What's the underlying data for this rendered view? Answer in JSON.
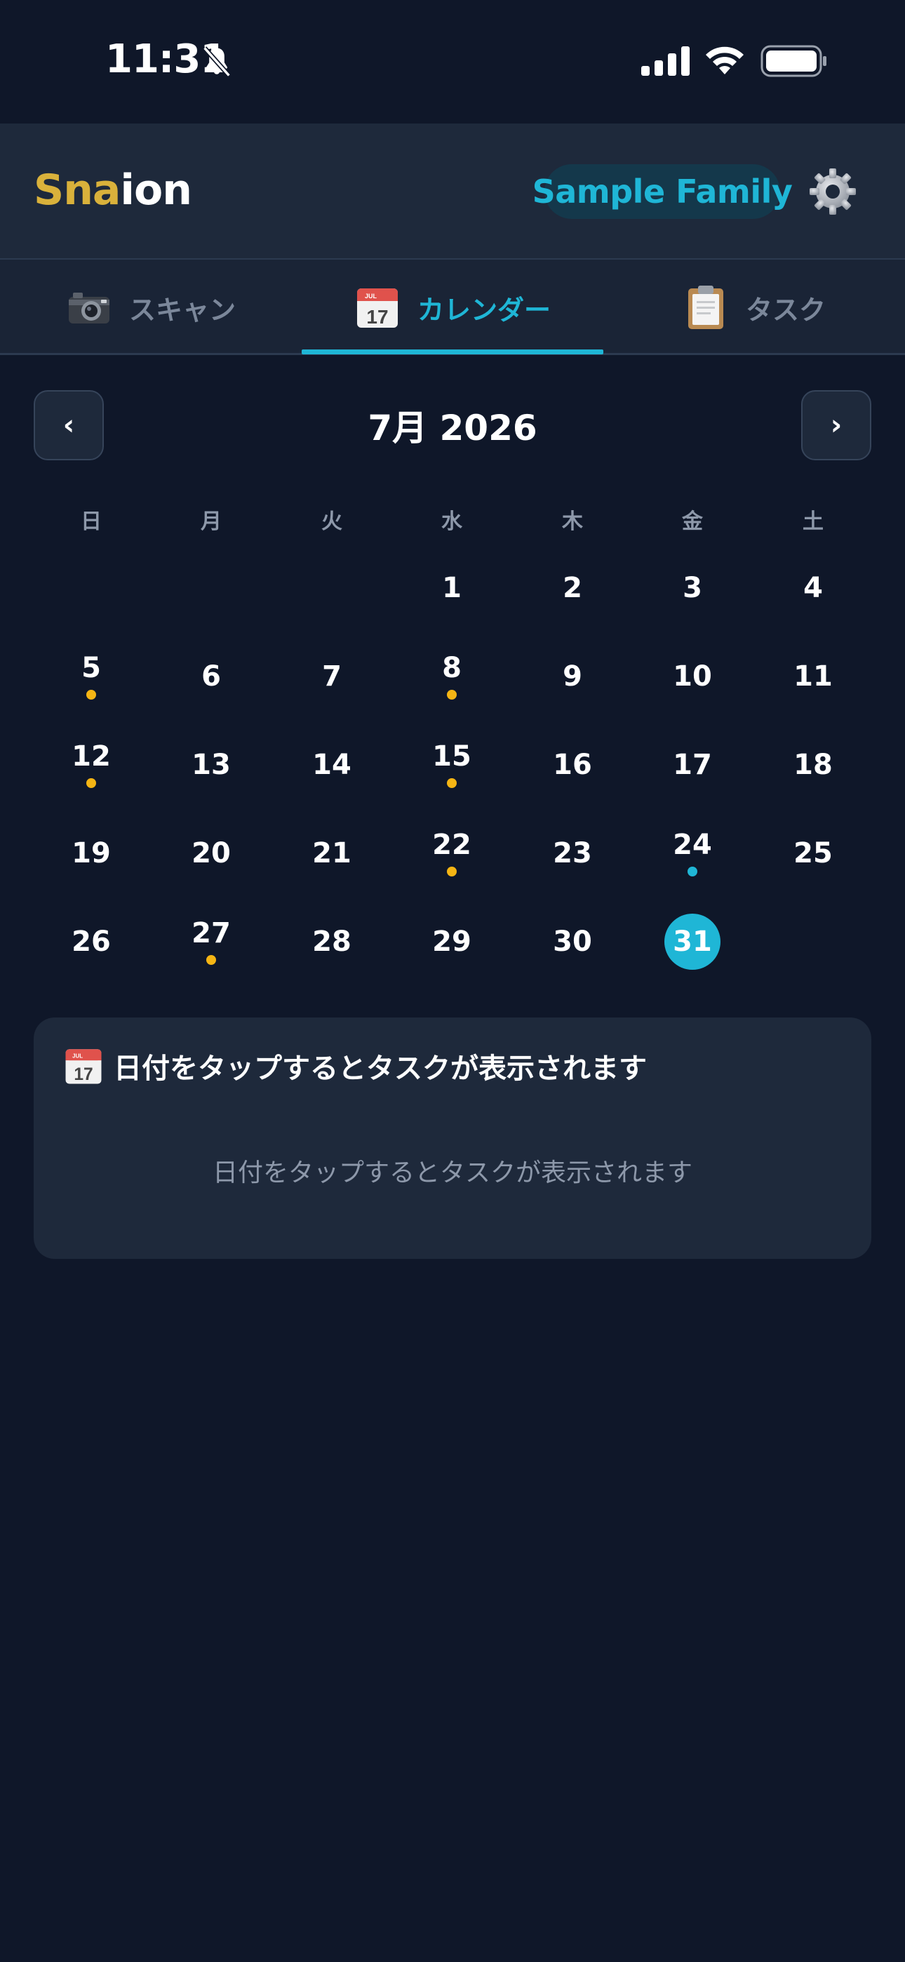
{
  "status_bar": {
    "time": "11:31",
    "icons": [
      "bell-slash-icon",
      "signal-icon",
      "wifi-icon",
      "battery-icon"
    ]
  },
  "header": {
    "logo_part1": "Sna",
    "logo_part2": "ion",
    "family_name": "Sample Family",
    "settings_icon": "gear-icon"
  },
  "tabs": [
    {
      "label": "スキャン",
      "icon": "camera-icon",
      "active": false
    },
    {
      "label": "カレンダー",
      "icon": "calendar-icon",
      "active": true
    },
    {
      "label": "タスク",
      "icon": "clipboard-icon",
      "active": false
    }
  ],
  "calendar": {
    "month_label": "7月 2026",
    "prev_label": "‹",
    "next_label": "›",
    "weekdays": [
      "日",
      "月",
      "火",
      "水",
      "木",
      "金",
      "土"
    ],
    "weeks": [
      [
        null,
        null,
        null,
        1,
        2,
        3,
        4
      ],
      [
        5,
        6,
        7,
        8,
        9,
        10,
        11
      ],
      [
        12,
        13,
        14,
        15,
        16,
        17,
        18
      ],
      [
        19,
        20,
        21,
        22,
        23,
        24,
        25
      ],
      [
        26,
        27,
        28,
        29,
        30,
        31,
        null
      ]
    ],
    "marked_days_gold": [
      5,
      8,
      12,
      15,
      22,
      27
    ],
    "marked_days_cyan": [
      24
    ],
    "today": 31
  },
  "card": {
    "title": "日付をタップするとタスクが表示されます",
    "empty_message": "日付をタップするとタスクが表示されます"
  },
  "colors": {
    "background": "#0f1729",
    "surface": "#1e293b",
    "accent": "#1fb6d6",
    "gold": "#d9b13b",
    "dot_gold": "#f5b514",
    "muted": "#8d98aa"
  }
}
